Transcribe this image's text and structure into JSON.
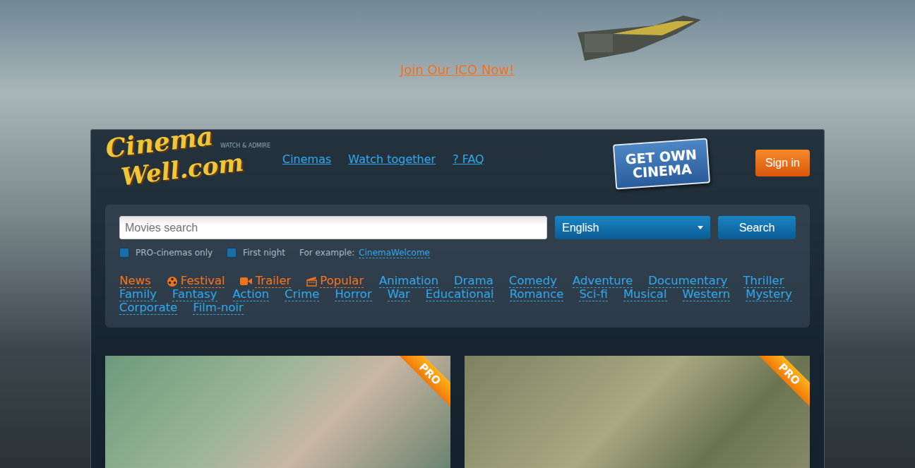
{
  "banner": {
    "link": "Join Our ICO Now!"
  },
  "logo": {
    "line1": "Cinema",
    "line2": "Well.com",
    "tagline": "WATCH & ADMIRE"
  },
  "nav": [
    {
      "label": "Cinemas"
    },
    {
      "label": "Watch together"
    },
    {
      "label": "? FAQ"
    }
  ],
  "promo": {
    "line1": "GET OWN",
    "line2": "CINEMA"
  },
  "sign_in": "Sign in",
  "search": {
    "placeholder": "Movies search",
    "language": "English",
    "button": "Search"
  },
  "filters": [
    {
      "label": "PRO-cinemas only",
      "checked": false
    },
    {
      "label": "First night",
      "checked": false
    }
  ],
  "example": {
    "label": "For example:",
    "link": "CinemaWelcome"
  },
  "genres": [
    {
      "label": "News",
      "kind": "featured"
    },
    {
      "label": "Festival",
      "kind": "festival"
    },
    {
      "label": "Trailer",
      "kind": "trailer"
    },
    {
      "label": "Popular",
      "kind": "popular"
    },
    {
      "label": "Animation",
      "kind": "genre"
    },
    {
      "label": "Drama",
      "kind": "genre"
    },
    {
      "label": "Comedy",
      "kind": "genre"
    },
    {
      "label": "Adventure",
      "kind": "genre"
    },
    {
      "label": "Documentary",
      "kind": "genre"
    },
    {
      "label": "Thriller",
      "kind": "genre"
    },
    {
      "label": "Family",
      "kind": "genre"
    },
    {
      "label": "Fantasy",
      "kind": "genre"
    },
    {
      "label": "Action",
      "kind": "genre"
    },
    {
      "label": "Crime",
      "kind": "genre"
    },
    {
      "label": "Horror",
      "kind": "genre"
    },
    {
      "label": "War",
      "kind": "genre"
    },
    {
      "label": "Educational",
      "kind": "genre"
    },
    {
      "label": "Romance",
      "kind": "genre"
    },
    {
      "label": "Sci-fi",
      "kind": "genre"
    },
    {
      "label": "Musical",
      "kind": "genre"
    },
    {
      "label": "Western",
      "kind": "genre"
    },
    {
      "label": "Mystery",
      "kind": "genre"
    },
    {
      "label": "Corporate",
      "kind": "genre"
    },
    {
      "label": "Film-noir",
      "kind": "genre"
    }
  ],
  "cards": [
    {
      "badge": "PRO"
    },
    {
      "badge": "PRO"
    }
  ]
}
